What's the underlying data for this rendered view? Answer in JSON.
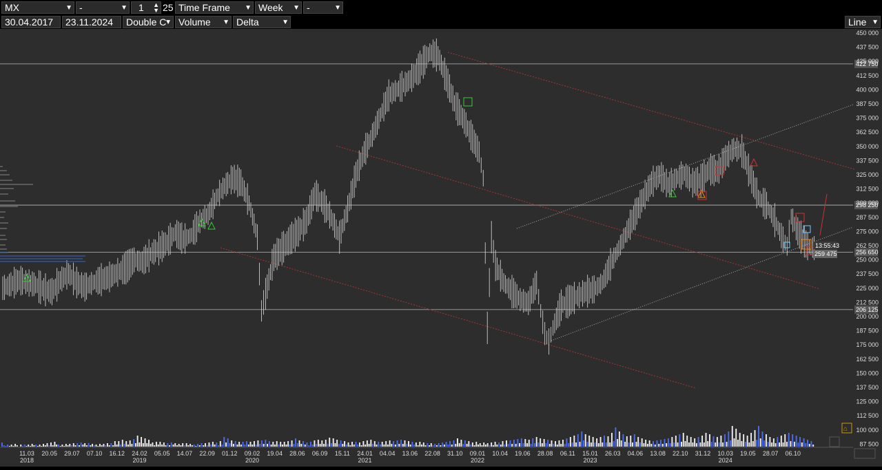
{
  "toolbar": {
    "symbol": "MX",
    "field2": "-",
    "multiplier": "1",
    "size": "25",
    "timeframe_label": "Time Frame",
    "period": "Week",
    "field7": "-",
    "date_from": "30.04.2017",
    "date_to": "23.11.2024",
    "chart_mode": "Double C",
    "indicator1": "Volume",
    "indicator2": "Delta",
    "style": "Line"
  },
  "chart_data": {
    "type": "bar",
    "title": "",
    "xlabel": "",
    "ylabel": "",
    "ylim": [
      75000,
      450000
    ],
    "grid": false,
    "y_ticks": [
      "450 000",
      "437 500",
      "425 000",
      "412 500",
      "400 000",
      "387 500",
      "375 000",
      "362 500",
      "350 000",
      "337 500",
      "325 000",
      "312 500",
      "300 000",
      "287 500",
      "275 000",
      "262 500",
      "250 000",
      "237 500",
      "225 000",
      "212 500",
      "200 000",
      "187 500",
      "175 000",
      "162 500",
      "150 000",
      "137 500",
      "125 000",
      "112 500",
      "100 000",
      "87 500"
    ],
    "x_ticks": [
      {
        "date": "11.03",
        "year": "2018"
      },
      {
        "date": "20.05",
        "year": ""
      },
      {
        "date": "29.07",
        "year": ""
      },
      {
        "date": "07.10",
        "year": ""
      },
      {
        "date": "16.12",
        "year": ""
      },
      {
        "date": "24.02",
        "year": "2019"
      },
      {
        "date": "05.05",
        "year": ""
      },
      {
        "date": "14.07",
        "year": ""
      },
      {
        "date": "22.09",
        "year": ""
      },
      {
        "date": "01.12",
        "year": ""
      },
      {
        "date": "09.02",
        "year": "2020"
      },
      {
        "date": "19.04",
        "year": ""
      },
      {
        "date": "28.06",
        "year": ""
      },
      {
        "date": "06.09",
        "year": ""
      },
      {
        "date": "15.11",
        "year": ""
      },
      {
        "date": "24.01",
        "year": "2021"
      },
      {
        "date": "04.04",
        "year": ""
      },
      {
        "date": "13.06",
        "year": ""
      },
      {
        "date": "22.08",
        "year": ""
      },
      {
        "date": "31.10",
        "year": ""
      },
      {
        "date": "09.01",
        "year": "2022"
      },
      {
        "date": "10.04",
        "year": ""
      },
      {
        "date": "19.06",
        "year": ""
      },
      {
        "date": "28.08",
        "year": ""
      },
      {
        "date": "06.11",
        "year": ""
      },
      {
        "date": "15.01",
        "year": "2023"
      },
      {
        "date": "26.03",
        "year": ""
      },
      {
        "date": "04.06",
        "year": ""
      },
      {
        "date": "13.08",
        "year": ""
      },
      {
        "date": "22.10",
        "year": ""
      },
      {
        "date": "31.12",
        "year": ""
      },
      {
        "date": "10.03",
        "year": "2024"
      },
      {
        "date": "19.05",
        "year": ""
      },
      {
        "date": "28.07",
        "year": ""
      },
      {
        "date": "06.10",
        "year": ""
      }
    ],
    "levels": [
      {
        "label": "422 750",
        "value": 422750
      },
      {
        "label": "298 250",
        "value": 298250
      },
      {
        "label": "256 650",
        "value": 256650
      },
      {
        "label": "206 125",
        "value": 206125
      }
    ],
    "last_price": {
      "label": "259 475",
      "value": 259475
    },
    "countdown": "13:55:43",
    "price_path": [
      [
        0,
        225000
      ],
      [
        4,
        232000
      ],
      [
        8,
        228000
      ],
      [
        10,
        224000
      ],
      [
        12,
        222000
      ],
      [
        14,
        232000
      ],
      [
        16,
        238000
      ],
      [
        18,
        230000
      ],
      [
        20,
        226000
      ],
      [
        22,
        230000
      ],
      [
        26,
        235000
      ],
      [
        30,
        243000
      ],
      [
        32,
        250000
      ],
      [
        34,
        248000
      ],
      [
        36,
        255000
      ],
      [
        40,
        265000
      ],
      [
        42,
        274000
      ],
      [
        44,
        268000
      ],
      [
        46,
        272000
      ],
      [
        48,
        284000
      ],
      [
        50,
        290000
      ],
      [
        52,
        305000
      ],
      [
        54,
        315000
      ],
      [
        56,
        322000
      ],
      [
        58,
        318000
      ],
      [
        60,
        300000
      ],
      [
        62,
        270000
      ],
      [
        63,
        205000
      ],
      [
        64,
        220000
      ],
      [
        66,
        252000
      ],
      [
        68,
        260000
      ],
      [
        70,
        268000
      ],
      [
        72,
        275000
      ],
      [
        74,
        285000
      ],
      [
        76,
        308000
      ],
      [
        78,
        300000
      ],
      [
        80,
        287000
      ],
      [
        82,
        270000
      ],
      [
        84,
        295000
      ],
      [
        86,
        325000
      ],
      [
        88,
        345000
      ],
      [
        90,
        360000
      ],
      [
        92,
        378000
      ],
      [
        94,
        395000
      ],
      [
        96,
        400000
      ],
      [
        98,
        405000
      ],
      [
        100,
        412000
      ],
      [
        102,
        422000
      ],
      [
        104,
        433000
      ],
      [
        106,
        430000
      ],
      [
        108,
        410000
      ],
      [
        110,
        388000
      ],
      [
        112,
        375000
      ],
      [
        114,
        360000
      ],
      [
        116,
        345000
      ],
      [
        117,
        322000
      ],
      [
        118,
        190000
      ],
      [
        119,
        270000
      ],
      [
        120,
        245000
      ],
      [
        122,
        230000
      ],
      [
        124,
        222000
      ],
      [
        126,
        215000
      ],
      [
        128,
        212000
      ],
      [
        130,
        230000
      ],
      [
        131,
        205000
      ],
      [
        132,
        185000
      ],
      [
        133,
        178000
      ],
      [
        134,
        190000
      ],
      [
        136,
        210000
      ],
      [
        138,
        214000
      ],
      [
        140,
        218000
      ],
      [
        142,
        222000
      ],
      [
        144,
        224000
      ],
      [
        146,
        230000
      ],
      [
        148,
        246000
      ],
      [
        150,
        260000
      ],
      [
        152,
        275000
      ],
      [
        154,
        290000
      ],
      [
        156,
        305000
      ],
      [
        158,
        318000
      ],
      [
        160,
        325000
      ],
      [
        162,
        316000
      ],
      [
        164,
        322000
      ],
      [
        166,
        326000
      ],
      [
        168,
        318000
      ],
      [
        170,
        320000
      ],
      [
        172,
        330000
      ],
      [
        174,
        328000
      ],
      [
        176,
        340000
      ],
      [
        178,
        348000
      ],
      [
        180,
        346000
      ],
      [
        182,
        325000
      ],
      [
        184,
        305000
      ],
      [
        186,
        298000
      ],
      [
        188,
        285000
      ],
      [
        190,
        268000
      ],
      [
        191,
        262000
      ],
      [
        192,
        288000
      ],
      [
        194,
        272000
      ],
      [
        196,
        262000
      ],
      [
        198,
        260000
      ]
    ],
    "volume_bars": [
      6,
      2,
      1,
      3,
      1,
      3,
      1,
      4,
      2,
      0,
      3,
      1,
      3,
      1,
      3,
      1,
      4,
      2,
      3,
      1,
      3,
      1,
      4,
      2,
      5,
      2,
      6,
      2,
      7,
      3,
      3,
      1,
      3,
      1,
      4,
      2,
      4,
      2,
      5,
      2,
      5,
      2,
      6,
      3,
      5,
      2,
      5,
      2,
      4,
      2,
      3,
      1,
      4,
      2,
      4,
      2,
      5,
      2,
      5,
      2,
      8,
      3,
      8,
      3,
      10,
      4,
      8,
      3,
      9,
      4,
      11,
      5,
      16,
      6,
      14,
      5,
      12,
      5,
      10,
      4,
      6,
      2,
      7,
      3,
      7,
      3,
      6,
      2,
      5,
      2,
      6,
      3,
      5,
      2,
      4,
      2,
      5,
      2,
      5,
      2,
      4,
      2,
      3,
      1,
      4,
      2,
      5,
      2,
      5,
      2,
      6,
      3,
      7,
      3,
      6,
      2,
      8,
      3,
      14,
      6,
      12,
      5,
      9,
      4,
      8,
      3,
      7,
      3,
      7,
      3,
      8,
      3,
      7,
      3,
      8,
      3,
      9,
      4,
      9,
      4,
      10,
      4,
      8,
      3,
      7,
      3,
      8,
      3,
      7,
      3,
      7,
      3,
      8,
      3,
      9,
      4,
      12,
      5,
      9,
      4,
      8,
      3,
      6,
      2,
      7,
      3,
      9,
      4,
      10,
      4,
      9,
      4,
      10,
      4,
      13,
      5,
      12,
      5,
      10,
      4,
      9,
      4,
      8,
      3,
      6,
      2,
      7,
      3,
      7,
      3,
      6,
      2,
      8,
      3,
      9,
      4,
      10,
      4,
      8,
      3,
      7,
      3,
      7,
      3,
      8,
      3,
      9,
      4,
      8,
      3,
      9,
      4,
      10,
      4,
      9,
      4,
      8,
      3,
      7,
      3,
      6,
      2,
      7,
      3,
      6,
      2,
      5,
      2,
      5,
      2,
      4,
      2,
      5,
      2,
      6,
      3,
      7,
      3,
      8,
      3,
      9,
      4,
      12,
      5,
      10,
      4,
      9,
      4,
      8,
      3,
      6,
      2,
      7,
      3,
      5,
      2,
      6,
      3,
      5,
      2,
      6,
      2,
      7,
      3,
      6,
      3,
      8,
      3,
      9,
      4,
      9,
      4,
      10,
      4,
      11,
      5,
      12,
      5,
      11,
      5,
      10,
      4,
      12,
      5,
      14,
      6,
      12,
      5,
      11,
      5,
      10,
      4,
      9,
      4,
      8,
      3,
      9,
      4,
      10,
      4,
      12,
      5,
      14,
      6,
      16,
      6,
      18,
      7,
      22,
      9,
      18,
      7,
      16,
      6,
      14,
      6,
      12,
      5,
      14,
      6,
      16,
      6,
      15,
      6,
      20,
      8,
      28,
      11,
      22,
      9,
      18,
      7,
      15,
      6,
      16,
      6,
      18,
      7,
      14,
      6,
      12,
      5,
      10,
      4,
      9,
      4,
      8,
      3,
      9,
      4,
      10,
      4,
      11,
      5,
      12,
      5,
      14,
      6,
      16,
      6,
      18,
      7,
      20,
      8,
      16,
      6,
      14,
      6,
      12,
      5,
      14,
      6,
      16,
      6,
      20,
      8,
      18,
      7,
      15,
      6,
      14,
      6,
      16,
      6,
      18,
      7,
      22,
      9,
      30,
      12,
      26,
      10,
      20,
      8,
      18,
      7,
      16,
      6,
      20,
      8,
      24,
      10,
      30,
      12,
      22,
      9,
      18,
      7,
      14,
      6,
      12,
      5,
      14,
      6,
      16,
      6,
      18,
      7,
      20,
      8,
      18,
      7,
      16,
      6,
      14,
      6,
      12,
      5,
      10,
      4,
      8,
      3
    ]
  }
}
